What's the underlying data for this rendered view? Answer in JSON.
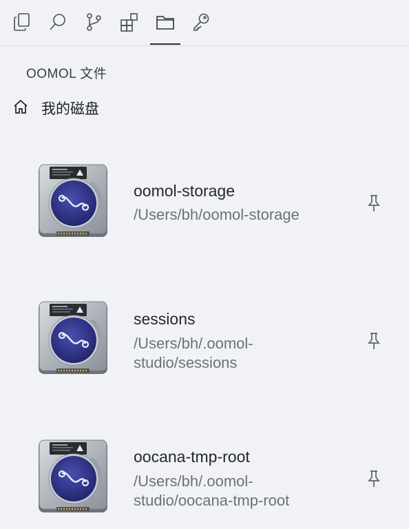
{
  "toolbar": {
    "tools": [
      {
        "icon": "copy-icon"
      },
      {
        "icon": "search-icon"
      },
      {
        "icon": "source-control-icon"
      },
      {
        "icon": "extensions-icon"
      },
      {
        "icon": "folder-icon",
        "active": true
      },
      {
        "icon": "key-icon"
      }
    ]
  },
  "section_title": "OOMOL 文件",
  "my_drive": {
    "label": "我的磁盘",
    "icon": "home-icon"
  },
  "items": [
    {
      "name": "oomol-storage",
      "path": "/Users/bh/oomol-storage"
    },
    {
      "name": "sessions",
      "path": "/Users/bh/.oomol-studio/sessions",
      "path_lines": [
        "/Users/bh/.oomol-",
        "studio/sessions"
      ]
    },
    {
      "name": "oocana-tmp-root",
      "path": "/Users/bh/.oomol-studio/oocana-tmp-root",
      "path_lines": [
        "/Users/bh/.oomol-",
        "studio/oocana-tmp-root"
      ]
    }
  ],
  "colors": {
    "background": "#f0f2f6",
    "text": "#24272d",
    "muted": "#6c7178",
    "disk_label": "#2e3282"
  }
}
